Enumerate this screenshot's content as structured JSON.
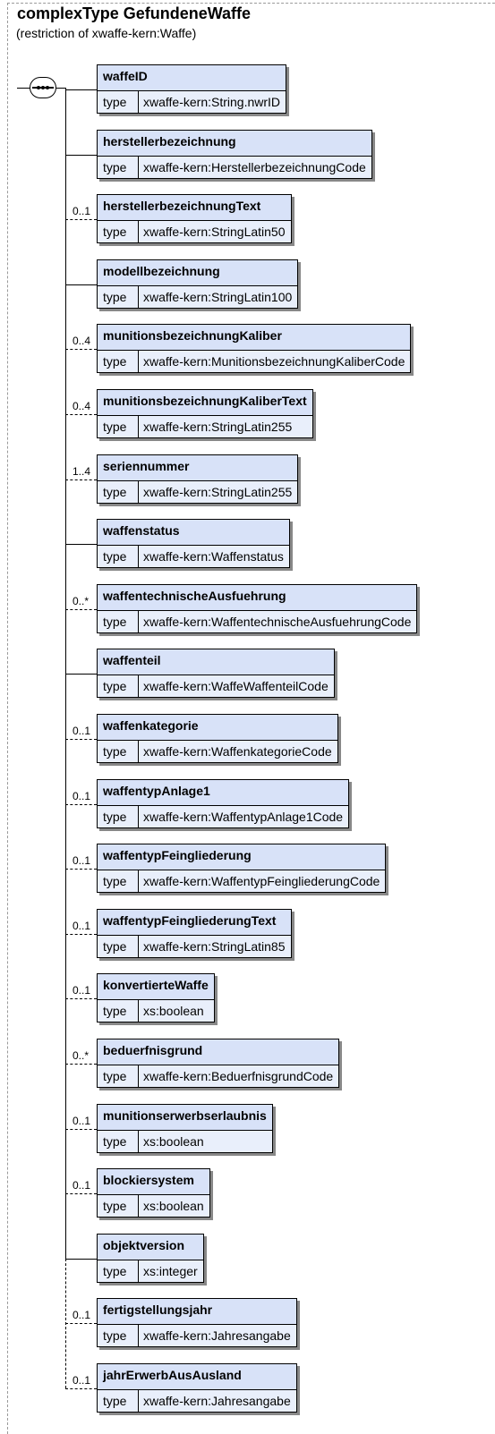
{
  "header": {
    "title": "complexType GefundeneWaffe",
    "subtitle": "(restriction of xwaffe-kern:Waffe)"
  },
  "type_label": "type",
  "elements": [
    {
      "name": "waffeID",
      "type": "xwaffe-kern:String.nwrID",
      "card": "",
      "optional": false
    },
    {
      "name": "herstellerbezeichnung",
      "type": "xwaffe-kern:HerstellerbezeichnungCode",
      "card": "",
      "optional": false
    },
    {
      "name": "herstellerbezeichnungText",
      "type": "xwaffe-kern:StringLatin50",
      "card": "0..1",
      "optional": false
    },
    {
      "name": "modellbezeichnung",
      "type": "xwaffe-kern:StringLatin100",
      "card": "",
      "optional": false
    },
    {
      "name": "munitionsbezeichnungKaliber",
      "type": "xwaffe-kern:MunitionsbezeichnungKaliberCode",
      "card": "0..4",
      "optional": false
    },
    {
      "name": "munitionsbezeichnungKaliberText",
      "type": "xwaffe-kern:StringLatin255",
      "card": "0..4",
      "optional": false
    },
    {
      "name": "seriennummer",
      "type": "xwaffe-kern:StringLatin255",
      "card": "1..4",
      "optional": false
    },
    {
      "name": "waffenstatus",
      "type": "xwaffe-kern:Waffenstatus",
      "card": "",
      "optional": false
    },
    {
      "name": "waffentechnischeAusfuehrung",
      "type": "xwaffe-kern:WaffentechnischeAusfuehrungCode",
      "card": "0..*",
      "optional": false
    },
    {
      "name": "waffenteil",
      "type": "xwaffe-kern:WaffeWaffenteilCode",
      "card": "",
      "optional": false
    },
    {
      "name": "waffenkategorie",
      "type": "xwaffe-kern:WaffenkategorieCode",
      "card": "0..1",
      "optional": false
    },
    {
      "name": "waffentypAnlage1",
      "type": "xwaffe-kern:WaffentypAnlage1Code",
      "card": "0..1",
      "optional": false
    },
    {
      "name": "waffentypFeingliederung",
      "type": "xwaffe-kern:WaffentypFeingliederungCode",
      "card": "0..1",
      "optional": false
    },
    {
      "name": "waffentypFeingliederungText",
      "type": "xwaffe-kern:StringLatin85",
      "card": "0..1",
      "optional": false
    },
    {
      "name": "konvertierteWaffe",
      "type": "xs:boolean",
      "card": "0..1",
      "optional": false
    },
    {
      "name": "beduerfnisgrund",
      "type": "xwaffe-kern:BeduerfnisgrundCode",
      "card": "0..*",
      "optional": false
    },
    {
      "name": "munitionserwerbserlaubnis",
      "type": "xs:boolean",
      "card": "0..1",
      "optional": false
    },
    {
      "name": "blockiersystem",
      "type": "xs:boolean",
      "card": "0..1",
      "optional": false
    },
    {
      "name": "objektversion",
      "type": "xs:integer",
      "card": "",
      "optional": false
    },
    {
      "name": "fertigstellungsjahr",
      "type": "xwaffe-kern:Jahresangabe",
      "card": "0..1",
      "optional": true
    },
    {
      "name": "jahrErwerbAusAusland",
      "type": "xwaffe-kern:Jahresangabe",
      "card": "0..1",
      "optional": true
    }
  ]
}
